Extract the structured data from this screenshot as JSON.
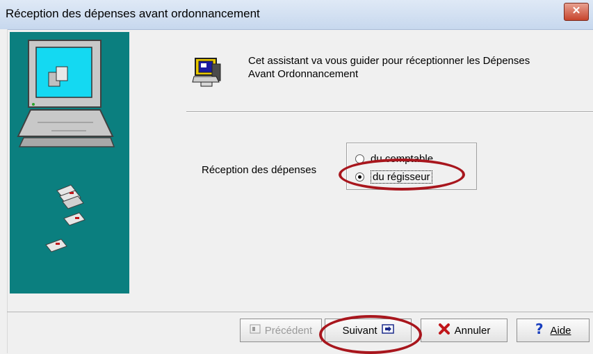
{
  "window": {
    "title": "Réception des dépenses avant ordonnancement",
    "close_label": "✕"
  },
  "intro": {
    "line1": "Cet assistant va vous guider pour réceptionner les Dépenses",
    "line2": "Avant Ordonnancement"
  },
  "reception": {
    "label": "Réception des dépenses",
    "options": [
      {
        "label": "du comptable",
        "selected": false
      },
      {
        "label": "du régisseur",
        "selected": true
      }
    ]
  },
  "buttons": {
    "previous": "Précédent",
    "next": "Suivant",
    "cancel": "Annuler",
    "help": "Aide"
  },
  "icons": {
    "close": "close-icon",
    "wizard": "wizard-icon",
    "computer": "computer-icon",
    "disks": "floppy-disk-icon",
    "previous": "previous-icon",
    "next": "next-icon",
    "cancel": "cancel-x-icon",
    "help": "help-question-icon"
  },
  "colors": {
    "side_panel": "#0b7f7f",
    "annotation": "#a8161d",
    "cancel_icon": "#c0161a",
    "help_icon": "#1a3fbf"
  }
}
